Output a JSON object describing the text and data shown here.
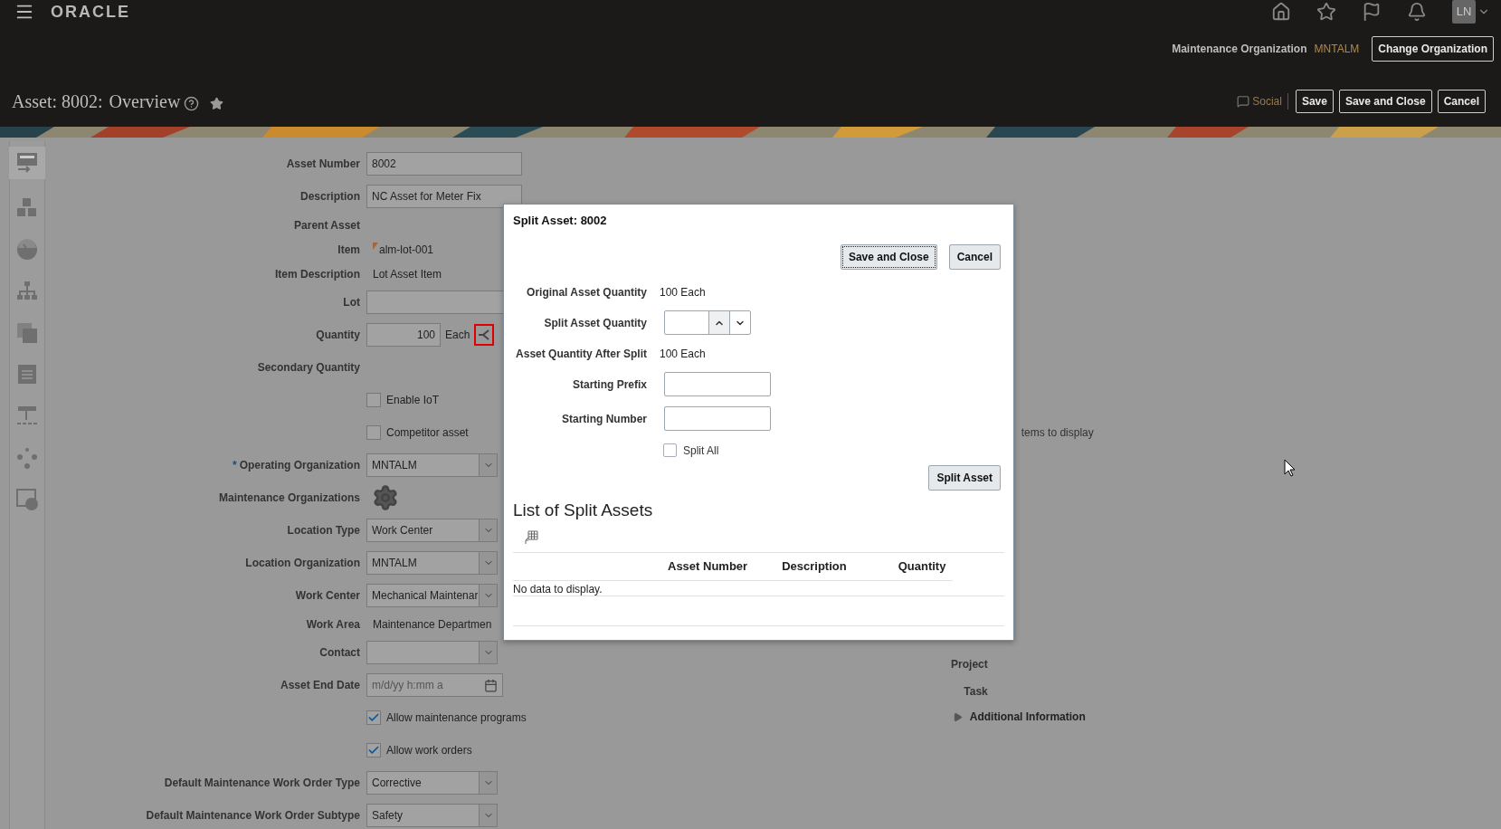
{
  "header": {
    "logo": "ORACLE",
    "avatar": "LN",
    "org_label": "Maintenance Organization",
    "org_value": "MNTALM",
    "change_button": "Change Organization",
    "title": "Asset: 8002:",
    "subtitle": "Overview",
    "actions": [
      {
        "kind": "social",
        "label": "Social"
      },
      {
        "kind": "button",
        "label": "Save"
      },
      {
        "kind": "button",
        "label": "Save and Close"
      },
      {
        "kind": "button",
        "label": "Cancel"
      }
    ]
  },
  "sidebar": {
    "items": [
      {
        "selected": true
      },
      {
        "selected": false
      },
      {
        "selected": false
      },
      {
        "selected": false
      },
      {
        "selected": false
      },
      {
        "selected": false
      },
      {
        "selected": false
      },
      {
        "selected": false
      },
      {
        "selected": false
      }
    ]
  },
  "form": {
    "fields": [
      {
        "kind": "text",
        "label": "Asset Number",
        "value": "8002"
      },
      {
        "kind": "text",
        "label": "Description",
        "value": "NC Asset for Meter Fix"
      },
      {
        "kind": "empty",
        "label": "Parent Asset"
      },
      {
        "kind": "item",
        "label": "Item",
        "value": "alm-lot-001"
      },
      {
        "kind": "display",
        "label": "Item Description",
        "value": "Lot Asset Item"
      },
      {
        "kind": "text",
        "label": "Lot"
      },
      {
        "kind": "quantity",
        "label": "Quantity",
        "value": "100",
        "unit": "Each"
      },
      {
        "kind": "empty",
        "label": "Secondary Quantity"
      },
      {
        "kind": "checkbox",
        "label": "Enable IoT",
        "checked": false
      },
      {
        "kind": "checkbox",
        "label": "Competitor asset",
        "checked": false
      },
      {
        "kind": "select",
        "label": "Operating Organization",
        "required_mark": "*",
        "value": "MNTALM"
      },
      {
        "kind": "gear",
        "label": "Maintenance Organizations"
      },
      {
        "kind": "select",
        "label": "Location Type",
        "value": "Work Center"
      },
      {
        "kind": "select",
        "label": "Location Organization",
        "value": "MNTALM"
      },
      {
        "kind": "select",
        "label": "Work Center",
        "value": "Mechanical Maintenar"
      },
      {
        "kind": "display",
        "label": "Work Area",
        "value": "Maintenance Departmen"
      },
      {
        "kind": "select",
        "label": "Contact"
      },
      {
        "kind": "date",
        "label": "Asset End Date",
        "placeholder": "m/d/yy h:mm a"
      },
      {
        "kind": "checkbox",
        "label": "Allow maintenance programs",
        "checked": true
      },
      {
        "kind": "checkbox",
        "label": "Allow work orders",
        "checked": true
      },
      {
        "kind": "select",
        "label": "Default Maintenance Work Order Type",
        "value": "Corrective"
      },
      {
        "kind": "select",
        "label": "Default Maintenance Work Order Subtype",
        "value": "Safety"
      }
    ]
  },
  "right_panel": {
    "empty_text": "tems to display",
    "labels": [
      "Project",
      "Task"
    ],
    "section": {
      "label": "Additional Information",
      "expanded": false
    }
  },
  "dialog": {
    "title": "Split Asset: 8002",
    "buttons": [
      {
        "label": "Save and Close",
        "focused": true
      },
      {
        "label": "Cancel",
        "focused": false
      }
    ],
    "rows": [
      {
        "kind": "display",
        "label": "Original Asset Quantity",
        "value": "100 Each"
      },
      {
        "kind": "spinner",
        "label": "Split Asset Quantity"
      },
      {
        "kind": "display",
        "label": "Asset Quantity After Split",
        "value": "100 Each"
      },
      {
        "kind": "input",
        "label": "Starting Prefix"
      },
      {
        "kind": "input",
        "label": "Starting Number"
      }
    ],
    "split_all": {
      "label": "Split All",
      "checked": false
    },
    "split_button": "Split Asset",
    "list_title": "List of Split Assets",
    "columns": [
      "Asset Number",
      "Description",
      "Quantity"
    ],
    "empty_message": "No data to display."
  }
}
